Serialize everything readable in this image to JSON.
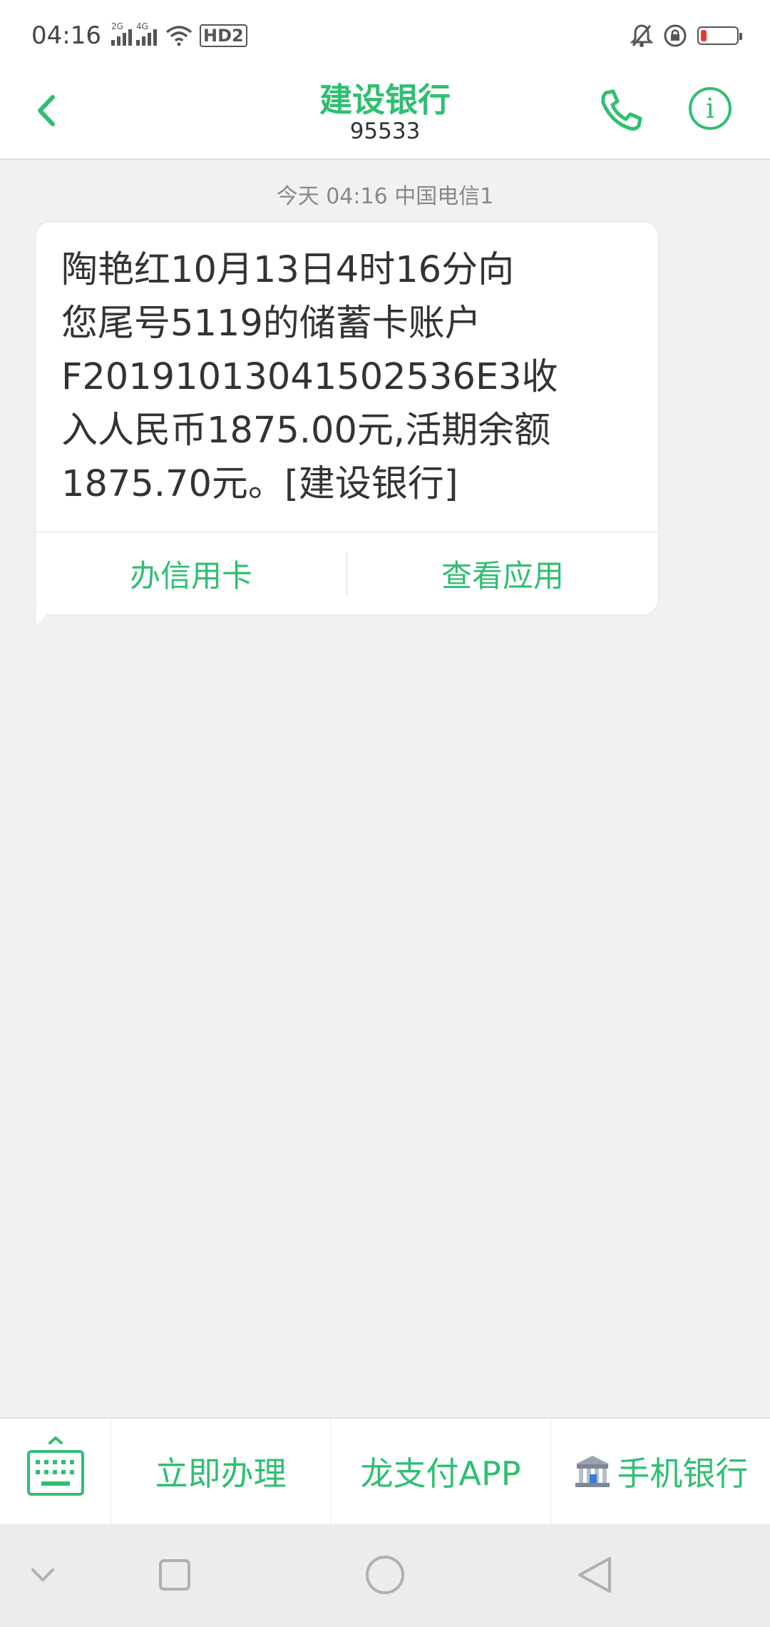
{
  "status_bar": {
    "time": "04:16",
    "signal1_label": "2G",
    "signal2_label": "4G",
    "hd_label": "HD2",
    "battery_level": 0.15,
    "battery_color": "#e53935"
  },
  "header": {
    "title": "建设银行",
    "number": "95533",
    "accent_color": "#2fbf71",
    "icons": [
      "back-arrow-icon",
      "phone-icon",
      "info-icon"
    ]
  },
  "conversation": {
    "timestamp": "今天 04:16  中国电信1",
    "message": {
      "text": "陶艳红10月13日4时16分向\n您尾号5119的储蓄卡账户\nF20191013041502536E3收\n入人民币1875.00元,活期余额\n1875.70元。[建设银行]",
      "actions": [
        "办信用卡",
        "查看应用"
      ]
    }
  },
  "bottom_menu": {
    "items": [
      "立即办理",
      "龙支付APP",
      "手机银行"
    ],
    "icons": [
      "keyboard-icon",
      "bank-icon"
    ]
  },
  "nav_bar": {
    "icons": [
      "collapse-icon",
      "recents-icon",
      "home-icon",
      "back-icon"
    ]
  }
}
